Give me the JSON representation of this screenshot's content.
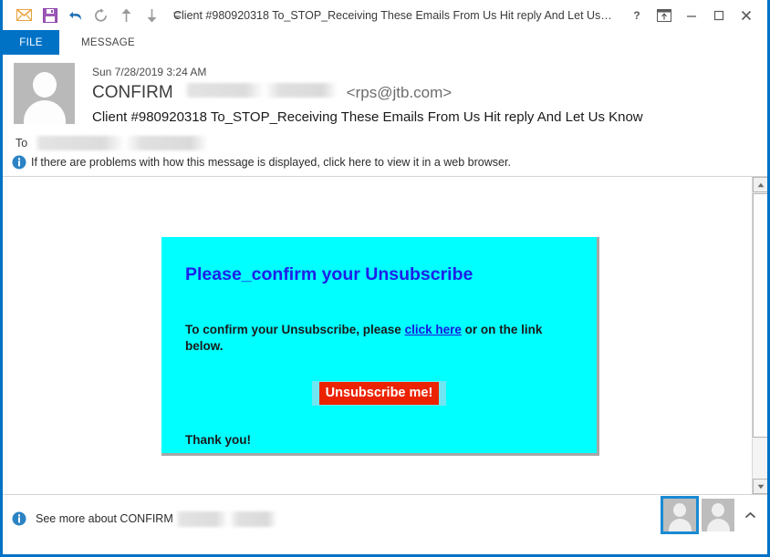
{
  "window": {
    "title": "Client #980920318 To_STOP_Receiving These Emails From Us Hit reply And Let Us Know -...",
    "accent_color": "#0072c6",
    "quick_access": [
      {
        "name": "mail-icon",
        "label": "Mail"
      },
      {
        "name": "save-icon",
        "label": "Save"
      },
      {
        "name": "undo-icon",
        "label": "Undo"
      },
      {
        "name": "redo-icon",
        "label": "Redo"
      },
      {
        "name": "previous-item-icon",
        "label": "Previous Item"
      },
      {
        "name": "next-item-icon",
        "label": "Next Item"
      },
      {
        "name": "customize-qat-icon",
        "label": "Customize Quick Access Toolbar"
      }
    ],
    "controls": [
      {
        "name": "help-button",
        "label": "?"
      },
      {
        "name": "ribbon-display-options-button",
        "label": "Ribbon Display Options"
      },
      {
        "name": "minimize-button",
        "label": "Minimize"
      },
      {
        "name": "maximize-button",
        "label": "Maximize"
      },
      {
        "name": "close-button",
        "label": "Close"
      }
    ]
  },
  "ribbon": {
    "file_tab": "FILE",
    "message_tab": "MESSAGE"
  },
  "message": {
    "date": "Sun 7/28/2019 3:24 AM",
    "sender_name": "CONFIRM",
    "sender_name_redacted": "",
    "sender_address": "<rps@jtb.com>",
    "subject": "Client #980920318 To_STOP_Receiving These Emails From Us Hit reply And Let Us Know",
    "to_label": "To",
    "to_value_redacted": "",
    "infobar": "If there are problems with how this message is displayed, click here to view it in a web browser.",
    "info_icon": "info-icon"
  },
  "body": {
    "background_color": "#00ffff",
    "heading": "Please_confirm your Unsubscribe",
    "paragraph_before_link": "To confirm your Unsubscribe, please ",
    "link_text": "click here",
    "paragraph_after_link": " or on the link below.",
    "button_label": "Unsubscribe me!",
    "button_color": "#ec2300",
    "closing": "Thank you!"
  },
  "scrollbar": {
    "up_arrow": "scroll-up-icon",
    "down_arrow": "scroll-down-icon"
  },
  "footer": {
    "see_more_prefix": "See more about CONFIRM",
    "see_more_redacted": "",
    "people": [
      {
        "name": "people-pane-avatar-1",
        "selected": true
      },
      {
        "name": "people-pane-avatar-2",
        "selected": false
      }
    ],
    "collapse_label": "Collapse People Pane"
  }
}
